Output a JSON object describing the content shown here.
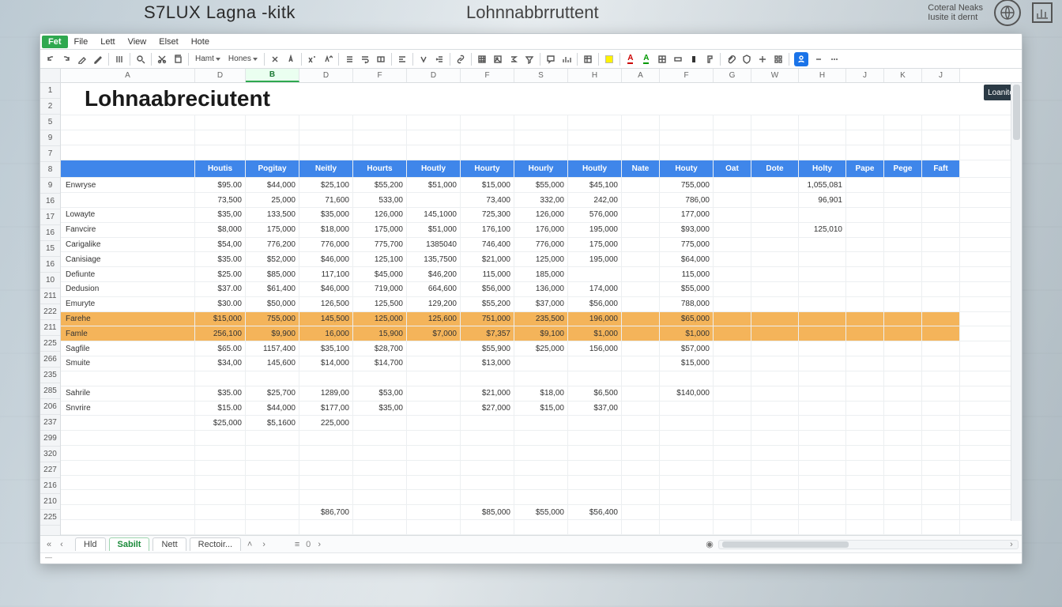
{
  "os_bar": {
    "title_a": "S7LUX Lagna -kitk",
    "title_b": "Lohnnabbrruttent",
    "info_line1": "Coteral Neaks",
    "info_line2": "Iusite it dernt",
    "right_tag": "Loanites"
  },
  "menu": {
    "items": [
      "Fet",
      "File",
      "Lett",
      "View",
      "Elset",
      "Hote"
    ],
    "active_index": 0
  },
  "toolbar": {
    "font_group_a": "Hamt",
    "font_group_b": "Hones"
  },
  "name_box": {
    "active_cell": "B"
  },
  "columns": [
    "A",
    "D",
    "B",
    "D",
    "F",
    "D",
    "F",
    "S",
    "H",
    "A",
    "F",
    "G",
    "W",
    "H",
    "J",
    "K",
    "J"
  ],
  "row_numbers": [
    "1",
    "2",
    "5",
    "9",
    "7",
    "8",
    "9",
    "16",
    "17",
    "16",
    "15",
    "16",
    "10",
    "211",
    "222",
    "211",
    "225",
    "266",
    "235",
    "285",
    "206",
    "237",
    "299",
    "320",
    "227",
    "216",
    "210",
    "225"
  ],
  "sheet_title": "Lohnaabreciutent",
  "headers": [
    "",
    "Houtis",
    "Pogitay",
    "Neitly",
    "Hourts",
    "Houtly",
    "Hourty",
    "Hourly",
    "Houtly",
    "Nate",
    "Houty",
    "Oat",
    "Dote",
    "Holty",
    "Pape",
    "Pege",
    "Faft"
  ],
  "rows": [
    {
      "name": "Enwryse",
      "vals": [
        "$95.00",
        "$44,000",
        "$25,100",
        "$55,200",
        "$51,000",
        "$15,000",
        "$55,000",
        "$45,100",
        "",
        "755,000",
        "",
        "",
        "1,055,081",
        "",
        "",
        ""
      ]
    },
    {
      "name": "",
      "vals": [
        "73,500",
        "25,000",
        "71,600",
        "533,00",
        "",
        "73,400",
        "332,00",
        "242,00",
        "",
        "786,00",
        "",
        "",
        "96,901",
        "",
        "",
        ""
      ]
    },
    {
      "name": "Lowayte",
      "vals": [
        "$35,00",
        "133,500",
        "$35,000",
        "126,000",
        "145,1000",
        "725,300",
        "126,000",
        "576,000",
        "",
        "177,000",
        "",
        "",
        "",
        "",
        "",
        ""
      ]
    },
    {
      "name": "Fanvcire",
      "vals": [
        "$8,000",
        "175,000",
        "$18,000",
        "175,000",
        "$51,000",
        "176,100",
        "176,000",
        "195,000",
        "",
        "$93,000",
        "",
        "",
        "125,010",
        "",
        "",
        ""
      ]
    },
    {
      "name": "Carigalike",
      "vals": [
        "$54,00",
        "776,200",
        "776,000",
        "775,700",
        "1385040",
        "746,400",
        "776,000",
        "175,000",
        "",
        "775,000",
        "",
        "",
        "",
        "",
        "",
        ""
      ]
    },
    {
      "name": "Canisiage",
      "vals": [
        "$35.00",
        "$52,000",
        "$46,000",
        "125,100",
        "135,7500",
        "$21,000",
        "125,000",
        "195,000",
        "",
        "$64,000",
        "",
        "",
        "",
        "",
        "",
        ""
      ]
    },
    {
      "name": "Defiunte",
      "vals": [
        "$25.00",
        "$85,000",
        "117,100",
        "$45,000",
        "$46,200",
        "115,000",
        "185,000",
        "",
        "",
        "115,000",
        "",
        "",
        "",
        "",
        "",
        ""
      ]
    },
    {
      "name": "Dedusion",
      "vals": [
        "$37.00",
        "$61,400",
        "$46,000",
        "719,000",
        "664,600",
        "$56,000",
        "136,000",
        "174,000",
        "",
        "$55,000",
        "",
        "",
        "",
        "",
        "",
        ""
      ]
    },
    {
      "name": "Emuryte",
      "vals": [
        "$30.00",
        "$50,000",
        "126,500",
        "125,500",
        "129,200",
        "$55,200",
        "$37,000",
        "$56,000",
        "",
        "788,000",
        "",
        "",
        "",
        "",
        "",
        ""
      ]
    },
    {
      "name": "Farehe",
      "vals": [
        "$15,000",
        "755,000",
        "145,500",
        "125,000",
        "125,600",
        "751,000",
        "235,500",
        "196,000",
        "",
        "$65,000",
        "",
        "",
        "",
        "",
        "",
        ""
      ],
      "highlight": true
    },
    {
      "name": "Famle",
      "vals": [
        "256,100",
        "$9,900",
        "16,000",
        "15,900",
        "$7,000",
        "$7,357",
        "$9,100",
        "$1,000",
        "",
        "$1,000",
        "",
        "",
        "",
        "",
        "",
        ""
      ],
      "highlight": true
    },
    {
      "name": "Sagfile",
      "vals": [
        "$65.00",
        "1157,400",
        "$35,100",
        "$28,700",
        "",
        "$55,900",
        "$25,000",
        "156,000",
        "",
        "$57,000",
        "",
        "",
        "",
        "",
        "",
        ""
      ]
    },
    {
      "name": "Smuite",
      "vals": [
        "$34,00",
        "145,600",
        "$14,000",
        "$14,700",
        "",
        "$13,000",
        "",
        "",
        "",
        "$15,000",
        "",
        "",
        "",
        "",
        "",
        ""
      ]
    },
    {
      "name": "",
      "vals": [
        "",
        "",
        "",
        "",
        "",
        "",
        "",
        "",
        "",
        "",
        "",
        "",
        "",
        "",
        "",
        ""
      ]
    },
    {
      "name": "Sahrile",
      "vals": [
        "$35.00",
        "$25,700",
        "1289,00",
        "$53,00",
        "",
        "$21,000",
        "$18,00",
        "$6,500",
        "",
        "$140,000",
        "",
        "",
        "",
        "",
        "",
        ""
      ]
    },
    {
      "name": "Snvrire",
      "vals": [
        "$15.00",
        "$44,000",
        "$177,00",
        "$35,00",
        "",
        "$27,000",
        "$15,00",
        "$37,00",
        "",
        "",
        "",
        "",
        "",
        "",
        "",
        ""
      ]
    },
    {
      "name": "",
      "vals": [
        "$25,000",
        "$5,1600",
        "225,000",
        "",
        "",
        "",
        "",
        "",
        "",
        "",
        "",
        "",
        "",
        "",
        "",
        ""
      ]
    },
    {
      "name": "",
      "vals": [
        "",
        "",
        "",
        "",
        "",
        "",
        "",
        "",
        "",
        "",
        "",
        "",
        "",
        "",
        "",
        ""
      ]
    },
    {
      "name": "",
      "vals": [
        "",
        "",
        "",
        "",
        "",
        "",
        "",
        "",
        "",
        "",
        "",
        "",
        "",
        "",
        "",
        ""
      ]
    },
    {
      "name": "",
      "vals": [
        "",
        "",
        "",
        "",
        "",
        "",
        "",
        "",
        "",
        "",
        "",
        "",
        "",
        "",
        "",
        ""
      ]
    },
    {
      "name": "",
      "vals": [
        "",
        "",
        "",
        "",
        "",
        "",
        "",
        "",
        "",
        "",
        "",
        "",
        "",
        "",
        "",
        ""
      ]
    },
    {
      "name": "",
      "vals": [
        "",
        "",
        "",
        "",
        "",
        "",
        "",
        "",
        "",
        "",
        "",
        "",
        "",
        "",
        "",
        ""
      ]
    },
    {
      "name": "",
      "vals": [
        "",
        "",
        "$86,700",
        "",
        "",
        "$85,000",
        "$55,000",
        "$56,400",
        "",
        "",
        "",
        "",
        "",
        "",
        "",
        ""
      ]
    },
    {
      "name": "",
      "vals": [
        "",
        "",
        "",
        "",
        "",
        "",
        "",
        "",
        "",
        "",
        "",
        "",
        "",
        "",
        "",
        ""
      ]
    }
  ],
  "tabs": {
    "items": [
      "Hld",
      "Sabilt",
      "Nett",
      "Rectoir..."
    ],
    "active_index": 1,
    "page_indicator": "0"
  },
  "status_text": "—"
}
